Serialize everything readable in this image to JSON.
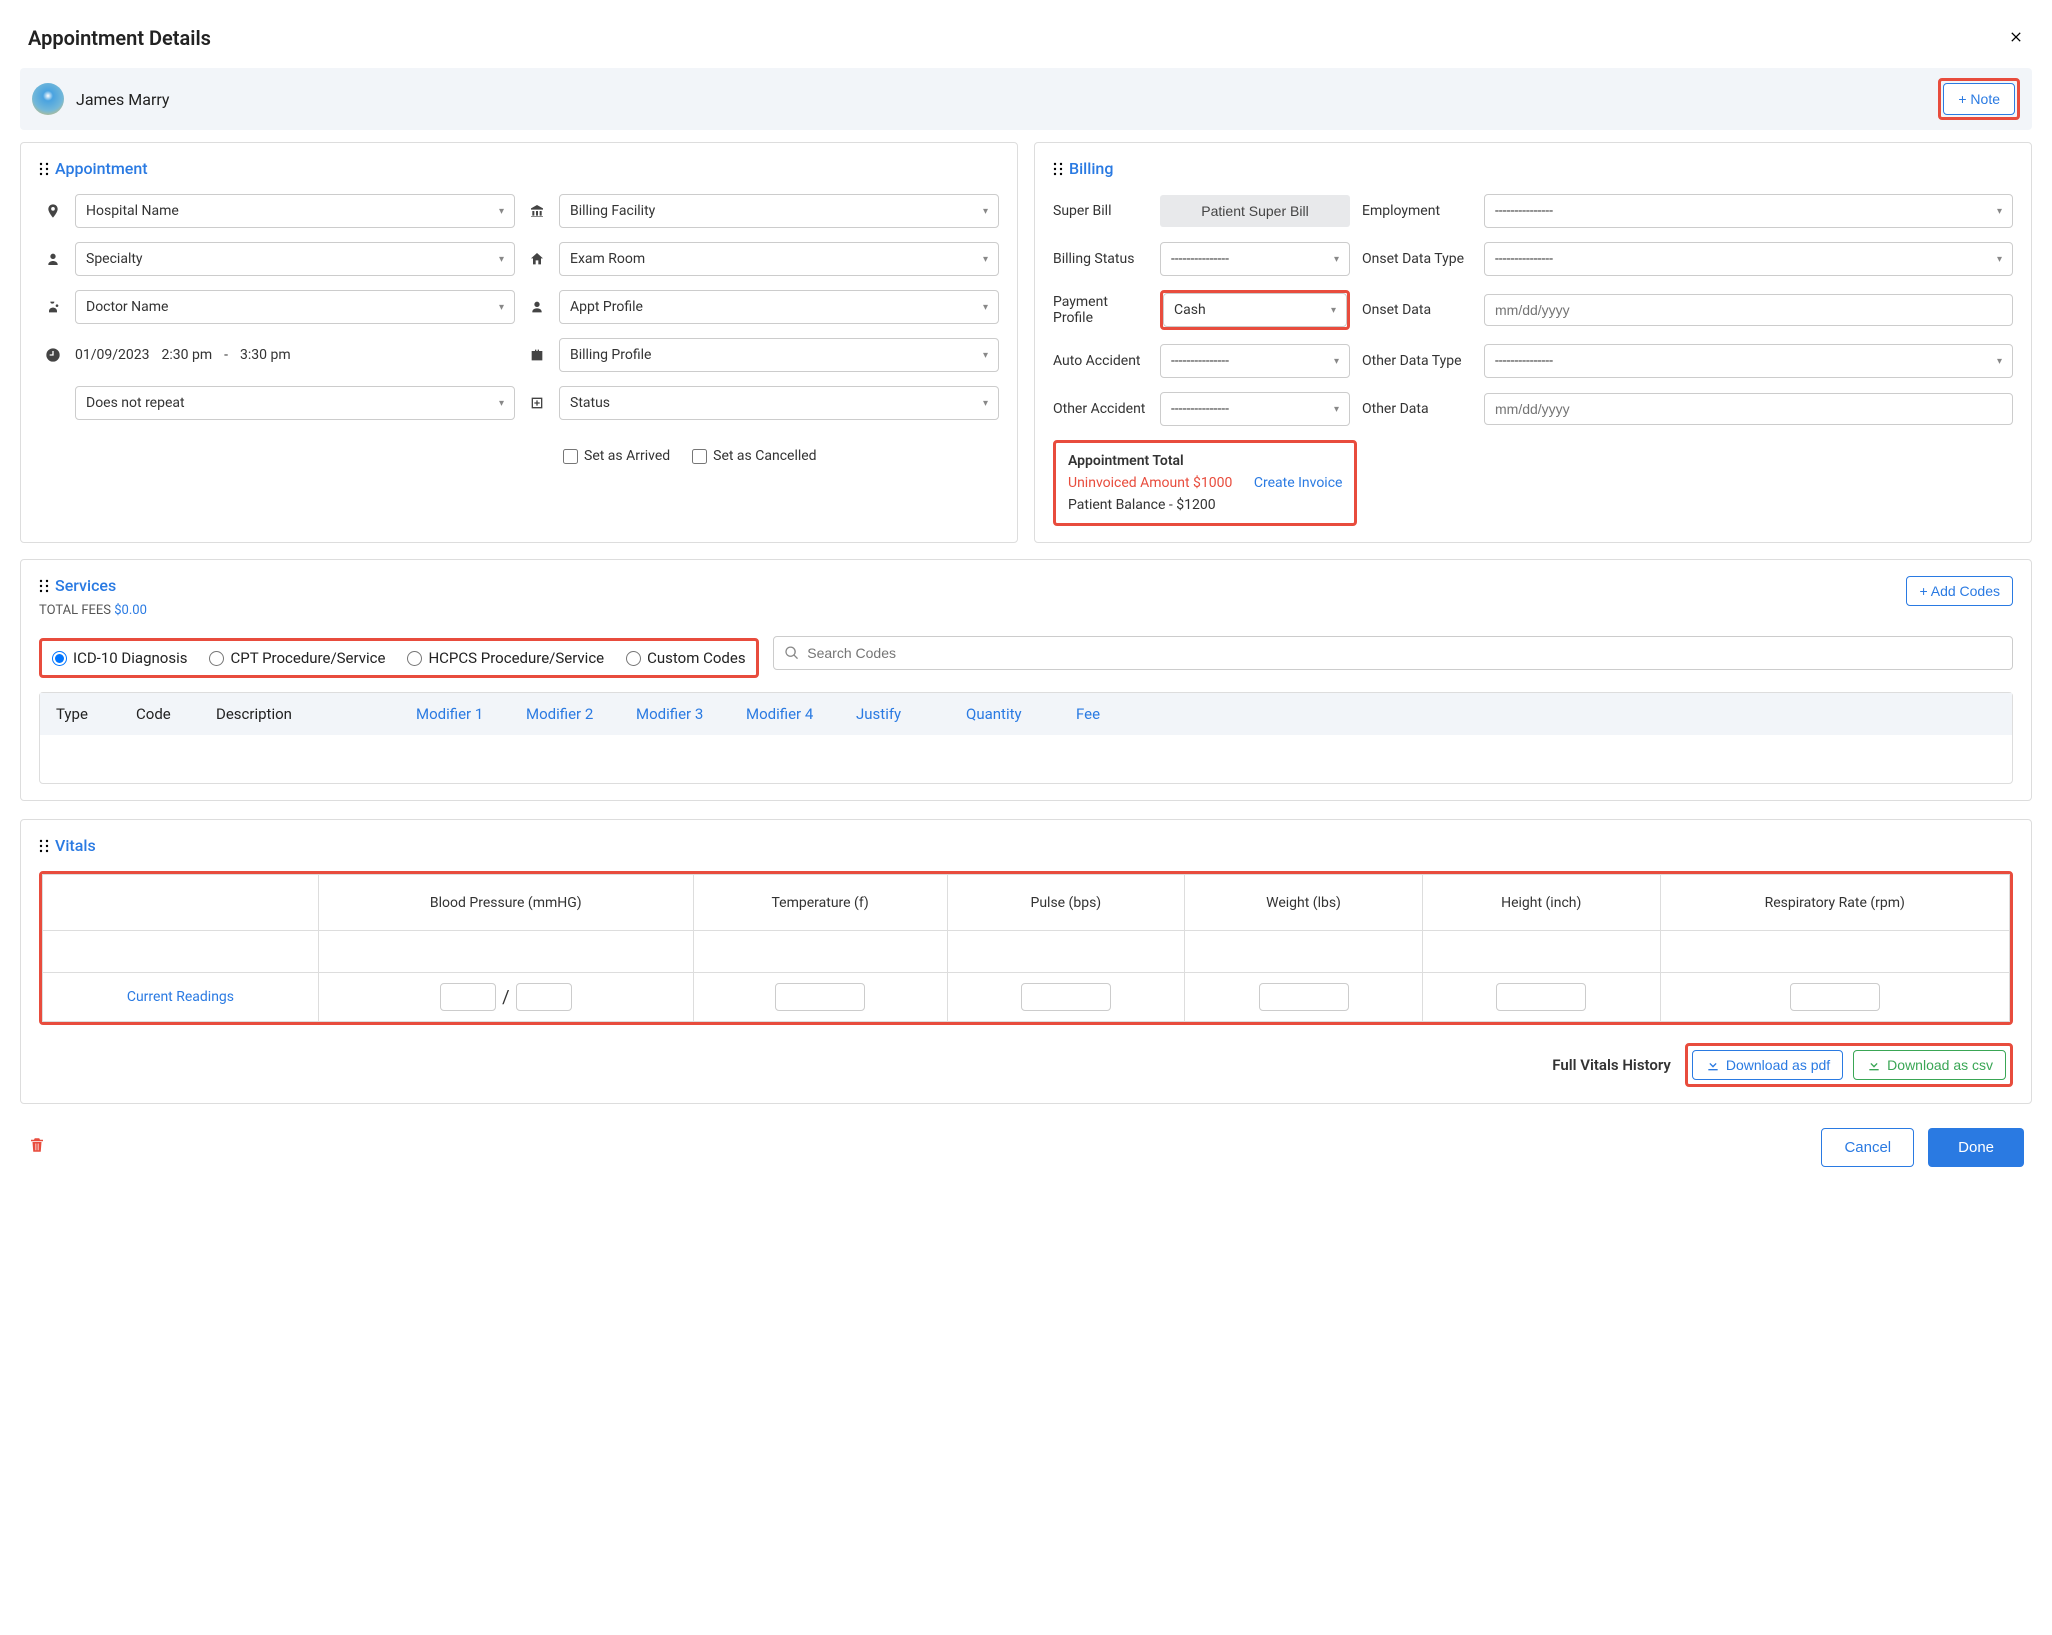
{
  "dialog": {
    "title": "Appointment Details"
  },
  "patient": {
    "name": "James Marry",
    "note_button": "+ Note"
  },
  "appointment": {
    "title": "Appointment",
    "hospital": "Hospital Name",
    "facility": "Billing Facility",
    "specialty": "Specialty",
    "exam_room": "Exam Room",
    "doctor": "Doctor Name",
    "appt_profile": "Appt Profile",
    "date": "01/09/2023",
    "time_start": "2:30 pm",
    "time_sep": "-",
    "time_end": "3:30 pm",
    "billing_profile": "Billing Profile",
    "repeat": "Does not repeat",
    "status": "Status",
    "set_arrived": "Set as Arrived",
    "set_cancelled": "Set as Cancelled"
  },
  "billing": {
    "title": "Billing",
    "rows": {
      "super_bill": "Super Bill",
      "super_bill_btn": "Patient Super Bill",
      "billing_status": "Billing Status",
      "payment_profile": "Payment Profile",
      "payment_profile_val": "Cash",
      "auto_accident": "Auto Accident",
      "other_accident": "Other Accident",
      "employment": "Employment",
      "onset_data_type": "Onset Data Type",
      "onset_data": "Onset Data",
      "other_data_type": "Other Data Type",
      "other_data": "Other Data",
      "dashes": "---------------",
      "date_placeholder": "mm/dd/yyyy"
    },
    "total": {
      "title": "Appointment Total",
      "uninvoiced": "Uninvoiced Amount $1000",
      "create_invoice": "Create Invoice",
      "balance": "Patient Balance - $1200"
    }
  },
  "services": {
    "title": "Services",
    "fees_label": "TOTAL FEES ",
    "fees_amount": "$0.00",
    "add_codes": "+ Add Codes",
    "radios": {
      "icd10": "ICD-10 Diagnosis",
      "cpt": "CPT Procedure/Service",
      "hcpcs": "HCPCS Procedure/Service",
      "custom": "Custom Codes"
    },
    "search_placeholder": "Search Codes",
    "columns": {
      "type": "Type",
      "code": "Code",
      "description": "Description",
      "mod1": "Modifier 1",
      "mod2": "Modifier 2",
      "mod3": "Modifier 3",
      "mod4": "Modifier 4",
      "justify": "Justify",
      "quantity": "Quantity",
      "fee": "Fee"
    }
  },
  "vitals": {
    "title": "Vitals",
    "headers": {
      "bp": "Blood Pressure (mmHG)",
      "temp": "Temperature (f)",
      "pulse": "Pulse (bps)",
      "weight": "Weight (lbs)",
      "height": "Height (inch)",
      "rr": "Respiratory Rate (rpm)"
    },
    "current_readings": "Current Readings",
    "bp_sep": "/",
    "history": "Full Vitals History",
    "dl_pdf": "Download as pdf",
    "dl_csv": "Download as csv"
  },
  "footer": {
    "cancel": "Cancel",
    "done": "Done"
  }
}
